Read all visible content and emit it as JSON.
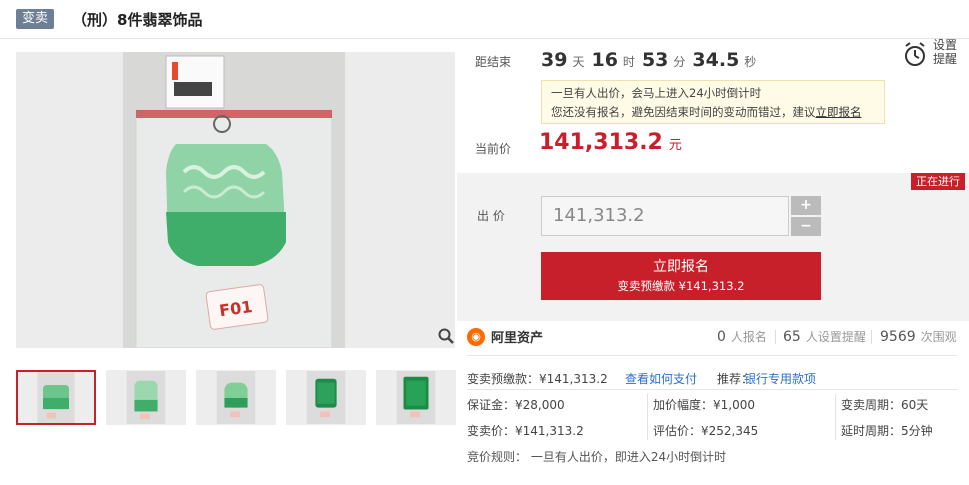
{
  "header": {
    "badge": "变卖",
    "title": "（刑）8件翡翠饰品"
  },
  "countdown": {
    "label": "距结束",
    "days": "39",
    "days_unit": "天",
    "hours": "16",
    "hours_unit": "时",
    "minutes": "53",
    "minutes_unit": "分",
    "seconds": "34.5",
    "seconds_unit": "秒"
  },
  "reminder": {
    "label_line1": "设置",
    "label_line2": "提醒"
  },
  "notice": {
    "line1": "一旦有人出价，会马上进入24小时倒计时",
    "line2_prefix": "您还没有报名，避免因结束时间的变动而错过，建议",
    "line2_link": "立即报名"
  },
  "current_price": {
    "label": "当前价",
    "amount": "141,313.2",
    "currency": "元"
  },
  "bid": {
    "status": "正在进行",
    "label": "出 价",
    "input_value": "141,313.2",
    "plus": "+",
    "minus": "−",
    "submit_line1": "立即报名",
    "submit_line2": "变卖预缴款 ¥141,313.2"
  },
  "platform": {
    "name": "阿里资产",
    "registered_count": "0",
    "registered_label": "人报名",
    "reminder_count": "65",
    "reminder_label": "人设置提醒",
    "views_count": "9569",
    "views_label": "次围观"
  },
  "details": {
    "deposit": "变卖预缴款：¥141,313.2",
    "how_to_pay": "查看如何支付",
    "recommend_label": "推荐：",
    "recommend_link": "银行专用款项",
    "guarantee": "保证金：¥28,000",
    "increment": "加价幅度：¥1,000",
    "period": "变卖周期：60天",
    "sale_price": "变卖价：¥141,313.2",
    "appraisal": "评估价：¥252,345",
    "delay": "延时周期：5分钟",
    "rule": "竞价规则：  一旦有人出价，即进入24小时倒计时"
  },
  "colors": {
    "accent": "#c8202a",
    "badge": "#6d7f95",
    "link": "#2a6fcf",
    "jade": "#3fae6a"
  }
}
